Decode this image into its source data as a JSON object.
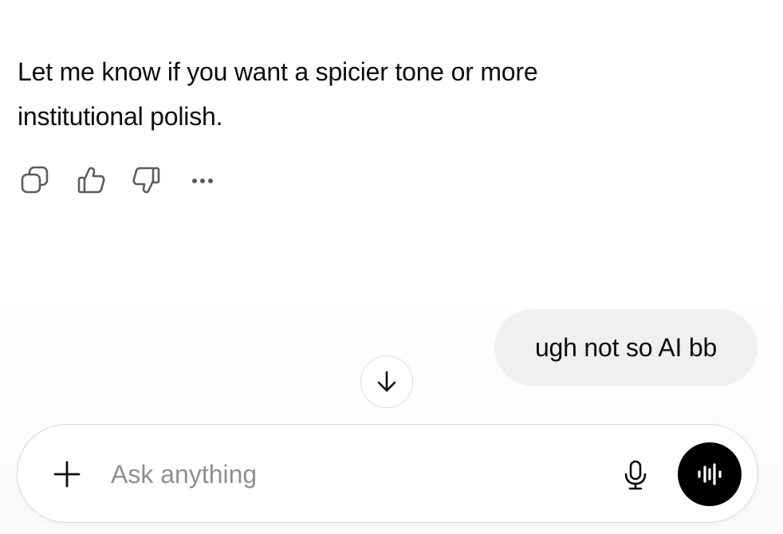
{
  "conversation": {
    "assistant_message": {
      "lines": [
        "Let me know if you want a spicier tone or more",
        "institutional polish."
      ]
    },
    "message_actions": [
      {
        "icon": "copy-icon"
      },
      {
        "icon": "thumbs-up-icon"
      },
      {
        "icon": "thumbs-down-icon"
      },
      {
        "icon": "more-options-icon"
      }
    ],
    "user_message": {
      "text": "ugh not so AI bb"
    }
  },
  "scroll_button": {
    "icon": "arrow-down-icon"
  },
  "composer": {
    "attach_icon": "plus-icon",
    "placeholder": "Ask anything",
    "value": "",
    "mic_icon": "microphone-icon",
    "voice_icon": "voice-mode-icon"
  },
  "colors": {
    "text": "#0d0d0d",
    "placeholder": "#8f8f8f",
    "user_bubble": "#f0f0f0",
    "voice_button": "#000000",
    "border": "#d9d9d9"
  }
}
